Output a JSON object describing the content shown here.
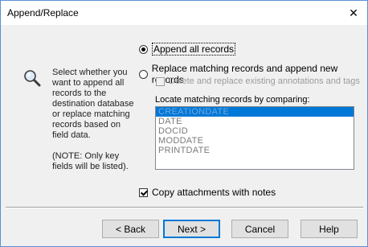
{
  "window": {
    "title": "Append/Replace",
    "close_glyph": "✕"
  },
  "info": {
    "icon": "search-icon",
    "text": "Select whether you want to append all records to the destination database or replace matching records based on field data.",
    "note": "(NOTE: Only key fields will be listed)."
  },
  "options": {
    "append_label": "Append all records",
    "append_selected": true,
    "replace_label": "Replace matching records and append new records",
    "replace_selected": false,
    "delete_label": "Delete and replace existing annotations and tags",
    "delete_checked": false
  },
  "locate": {
    "label": "Locate matching records by comparing:",
    "items": [
      "CREATIONDATE",
      "DATE",
      "DOCID",
      "MODDATE",
      "PRINTDATE"
    ],
    "selected_index": 0
  },
  "copy_attachments": {
    "label": "Copy attachments with notes",
    "checked": true
  },
  "buttons": {
    "back": "< Back",
    "next": "Next >",
    "cancel": "Cancel",
    "help": "Help"
  }
}
